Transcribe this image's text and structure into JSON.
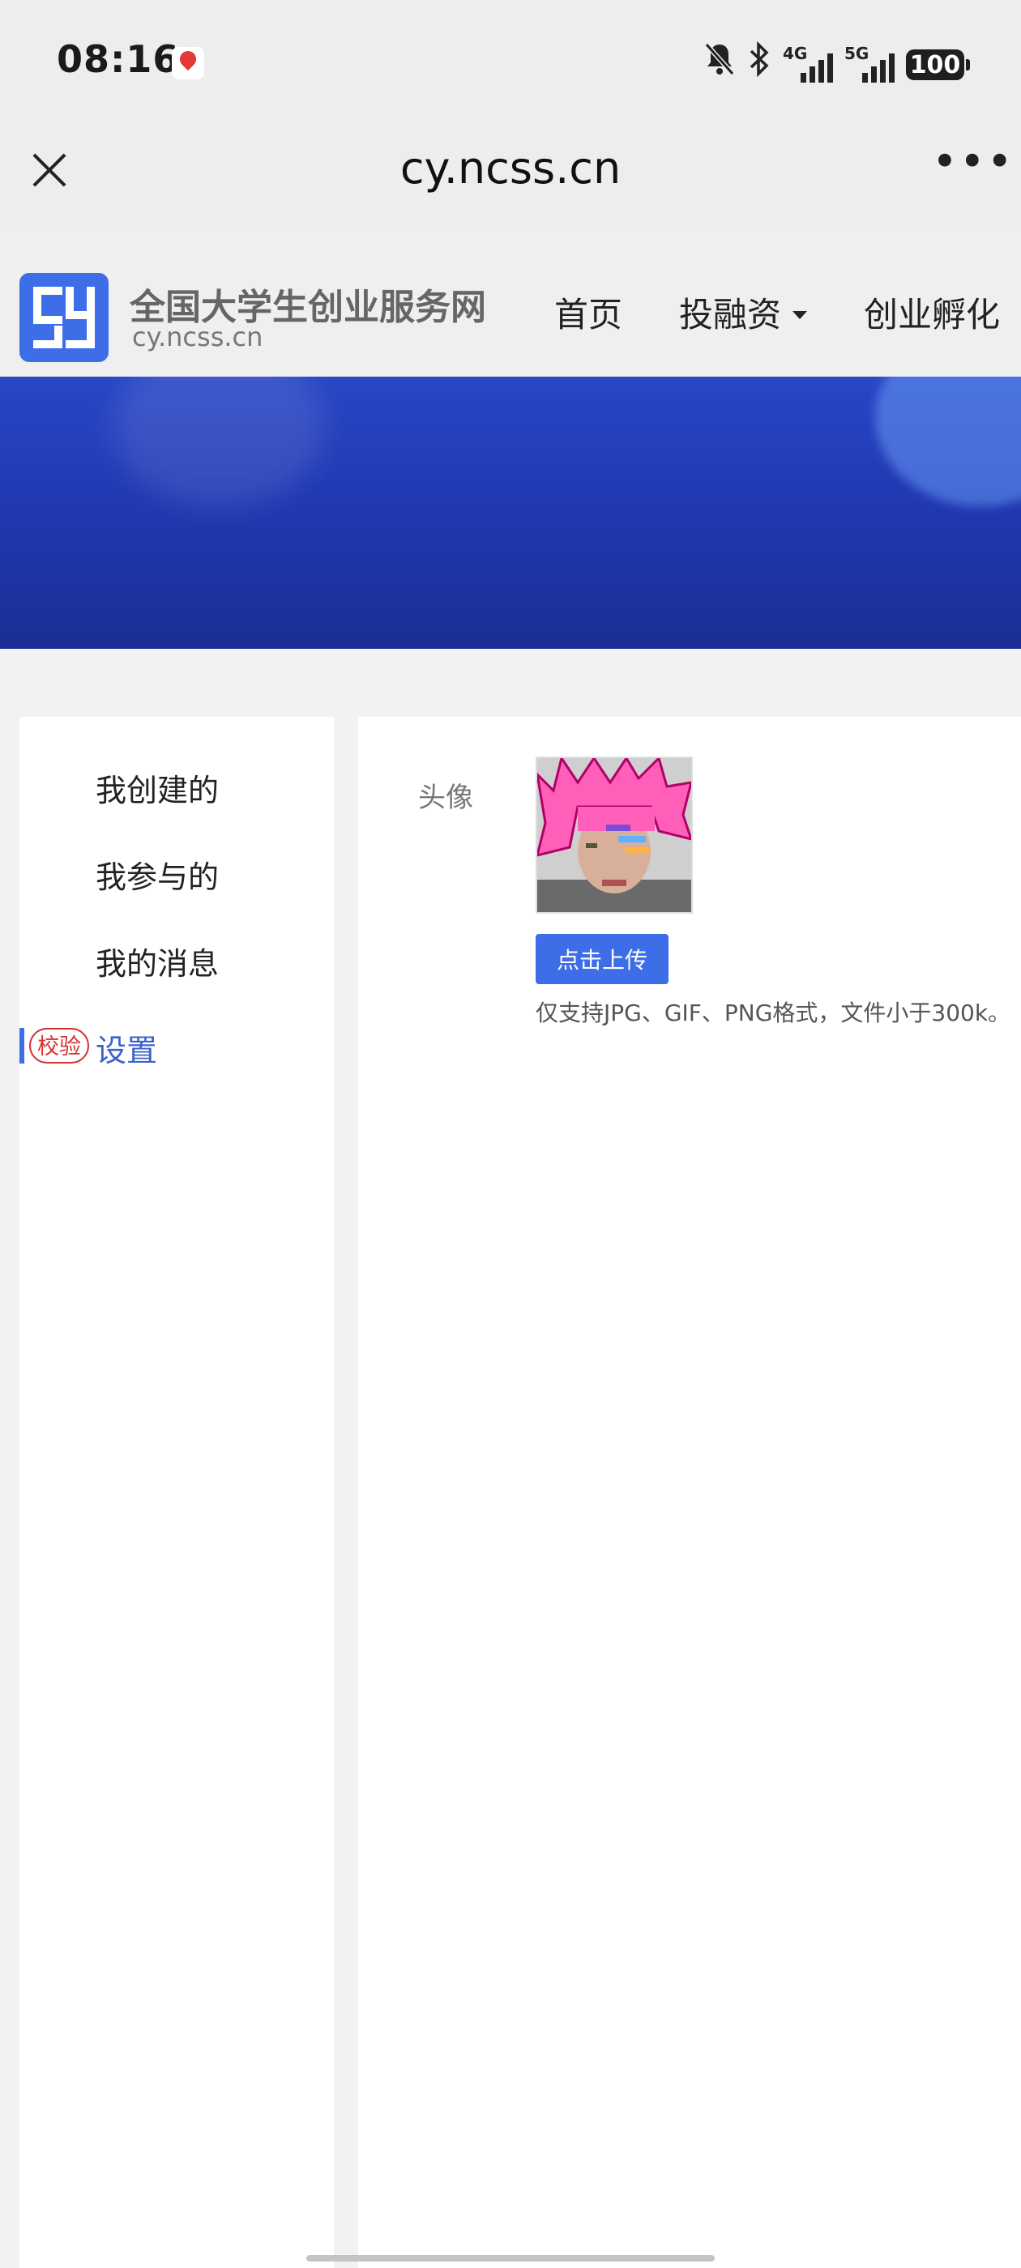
{
  "status_bar": {
    "time": "08:16",
    "network_1": "4G",
    "network_2": "5G",
    "battery": "100"
  },
  "browser": {
    "url": "cy.ncss.cn",
    "more_glyph": "•••"
  },
  "site": {
    "title": "全国大学生创业服务网",
    "domain": "cy.ncss.cn",
    "nav": [
      {
        "label": "首页"
      },
      {
        "label": "投融资"
      },
      {
        "label": "创业孵化"
      }
    ]
  },
  "sidebar": {
    "items": [
      {
        "label": "我创建的"
      },
      {
        "label": "我参与的"
      },
      {
        "label": "我的消息"
      },
      {
        "label": "设置"
      }
    ],
    "badge": "校验"
  },
  "profile": {
    "avatar_label": "头像",
    "upload_button": "点击上传",
    "hint": "仅支持JPG、GIF、PNG格式，文件小于300k。"
  },
  "colors": {
    "accent": "#3d6ee8",
    "badge_red": "#d43030",
    "banner": "#2039b2"
  }
}
